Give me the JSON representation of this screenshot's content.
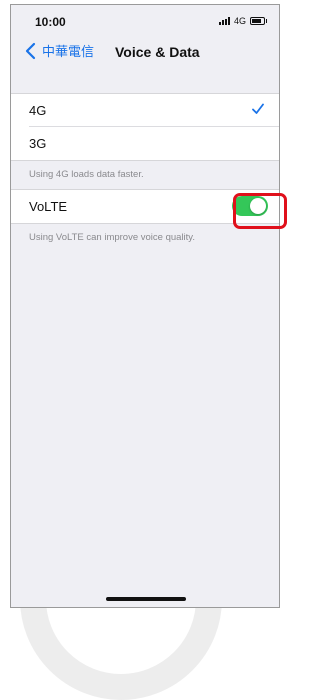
{
  "status_bar": {
    "time": "10:00",
    "network": "4G"
  },
  "nav": {
    "back_label": "中華電信",
    "title": "Voice & Data"
  },
  "network_options": [
    {
      "label": "4G",
      "selected": true
    },
    {
      "label": "3G",
      "selected": false
    }
  ],
  "network_footer": "Using 4G loads data faster.",
  "volte": {
    "label": "VoLTE",
    "enabled": true,
    "footer": "Using VoLTE can improve voice quality."
  },
  "colors": {
    "accent": "#1a73e8",
    "toggle_on": "#34c759",
    "highlight": "#e0101b"
  }
}
